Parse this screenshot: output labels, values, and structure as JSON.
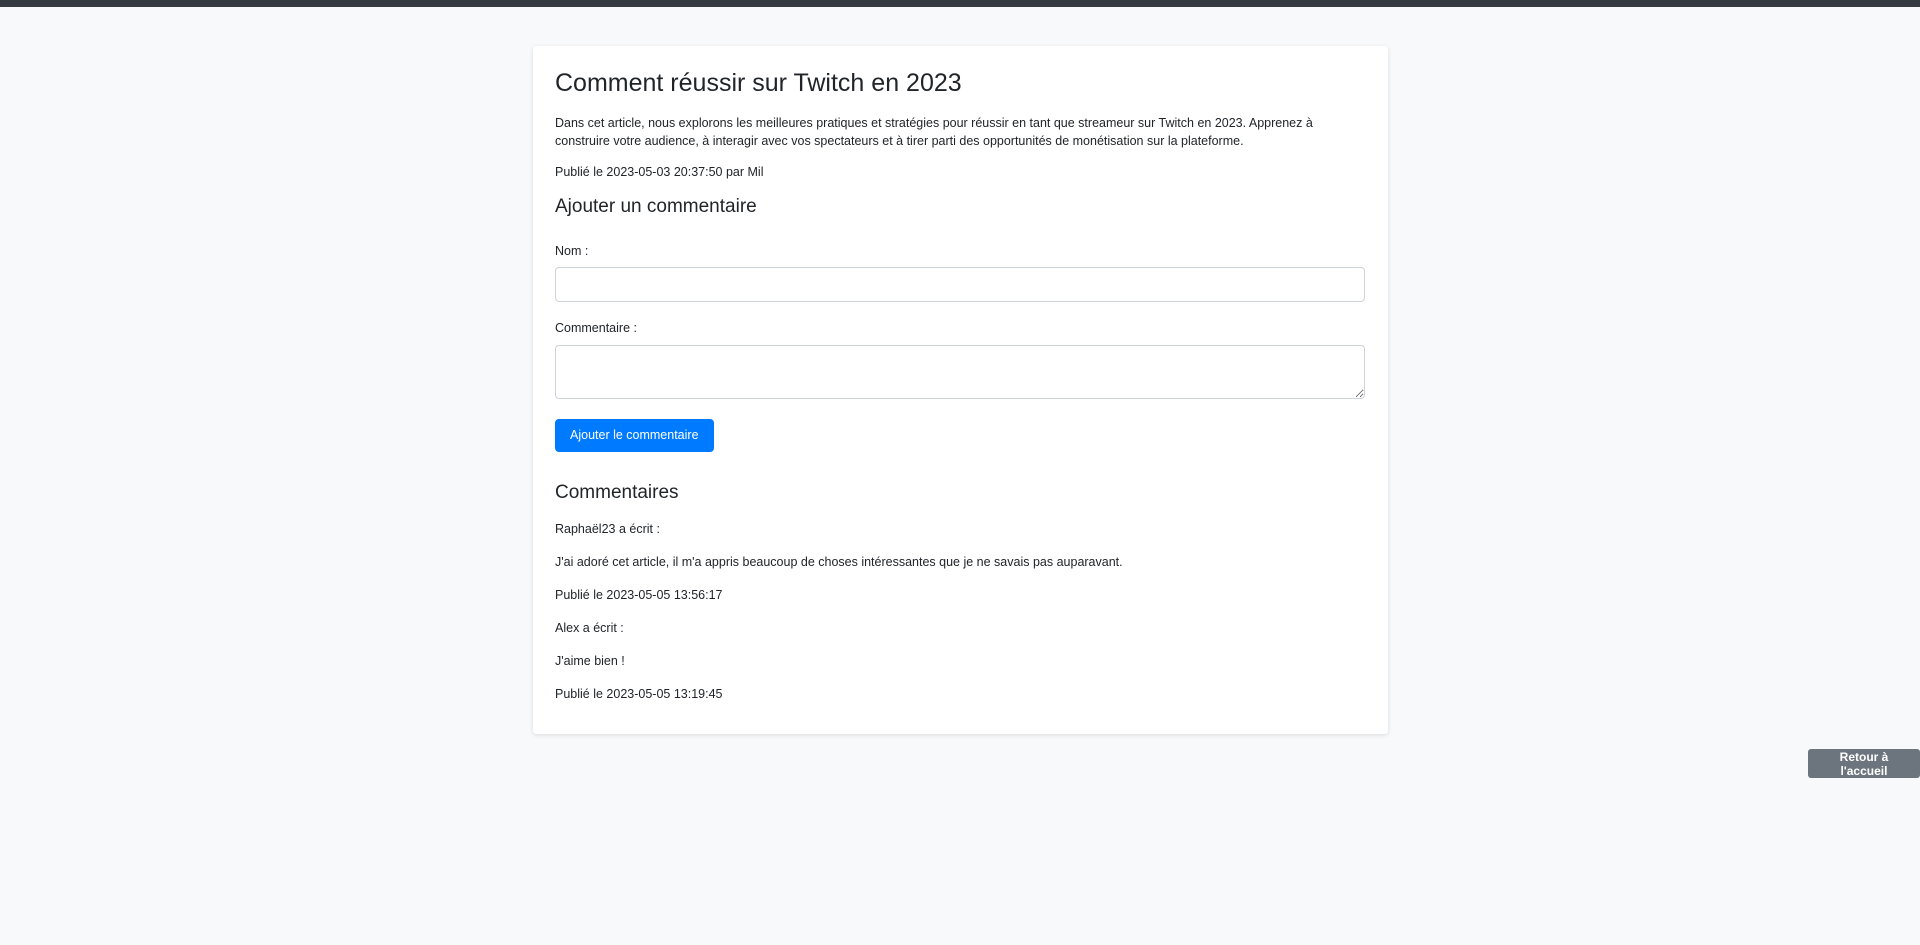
{
  "article": {
    "title": "Comment réussir sur Twitch en 2023",
    "description": "Dans cet article, nous explorons les meilleures pratiques et stratégies pour réussir en tant que streameur sur Twitch en 2023. Apprenez à construire votre audience, à interagir avec vos spectateurs et à tirer parti des opportunités de monétisation sur la plateforme.",
    "meta": "Publié le 2023-05-03 20:37:50 par Mil"
  },
  "form": {
    "heading": "Ajouter un commentaire",
    "name_label": "Nom :",
    "name_value": "",
    "comment_label": "Commentaire :",
    "comment_value": "",
    "submit_label": "Ajouter le commentaire"
  },
  "comments": {
    "heading": "Commentaires",
    "items": [
      {
        "author": "Raphaël23 a écrit :",
        "text": "J'ai adoré cet article, il m'a appris beaucoup de choses intéressantes que je ne savais pas auparavant.",
        "date": "Publié le 2023-05-05 13:56:17"
      },
      {
        "author": "Alex a écrit :",
        "text": "J'aime bien !",
        "date": "Publié le 2023-05-05 13:19:45"
      }
    ]
  },
  "nav": {
    "back_label": "Retour à l'accueil"
  },
  "colors": {
    "primary": "#007bff",
    "secondary": "#6c757d",
    "topbar": "#343a40",
    "background": "#f8f9fa"
  }
}
